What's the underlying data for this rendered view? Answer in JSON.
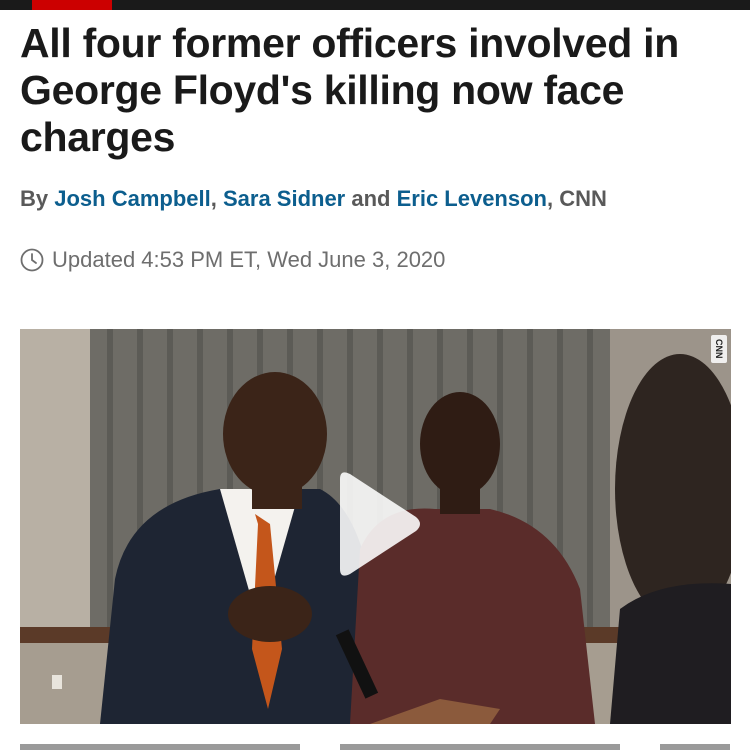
{
  "article": {
    "headline": "All four former officers involved in George Floyd's killing now face charges",
    "byline": {
      "prefix": "By ",
      "authors": [
        "Josh Campbell",
        "Sara Sidner",
        "Eric Levenson"
      ],
      "sep1": ", ",
      "sep2": " and ",
      "sep3": ", ",
      "source": "CNN"
    },
    "updated": "Updated 4:53 PM ET, Wed June 3, 2020"
  },
  "video": {
    "watermark": "CNN",
    "play_icon": "play-icon"
  },
  "colors": {
    "brand_red": "#cc0000",
    "author_link": "#0c5e8e",
    "headline": "#1a1a1a"
  }
}
